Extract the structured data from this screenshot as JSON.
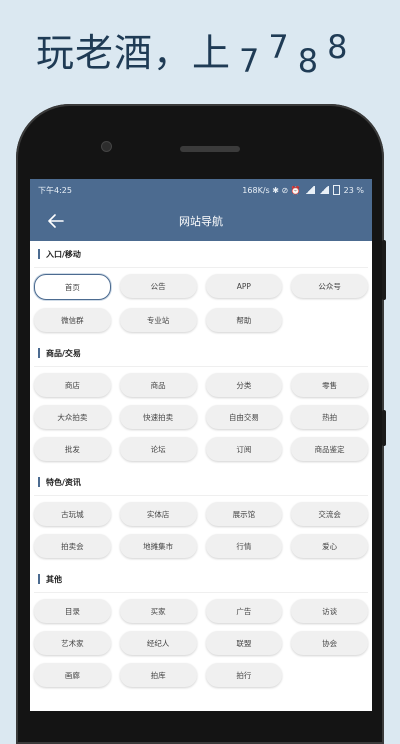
{
  "slogan": {
    "text": "玩老酒，上",
    "d1": "7",
    "d2": "7",
    "d3": "8",
    "d4": "8"
  },
  "status_bar": {
    "time": "下午4:25",
    "right": "168K/s ✱ ⊘ ⏰",
    "battery": "23 %"
  },
  "appbar": {
    "title": "网站导航"
  },
  "accent_color": "#4c6b90",
  "sections": [
    {
      "title": "入口/移动",
      "items": [
        "首页",
        "公告",
        "APP",
        "公众号",
        "微信群",
        "专业站",
        "帮助"
      ]
    },
    {
      "title": "商品/交易",
      "items": [
        "商店",
        "商品",
        "分类",
        "零售",
        "大众拍卖",
        "快速拍卖",
        "自由交易",
        "热拍",
        "批发",
        "论坛",
        "订阅",
        "商品鉴定"
      ]
    },
    {
      "title": "特色/资讯",
      "items": [
        "古玩城",
        "实体店",
        "展示馆",
        "交流会",
        "拍卖会",
        "地摊集市",
        "行情",
        "爱心"
      ]
    },
    {
      "title": "其他",
      "items": [
        "目录",
        "买家",
        "广告",
        "访谈",
        "艺术家",
        "经纪人",
        "联盟",
        "协会",
        "画廊",
        "拍库",
        "拍行"
      ]
    }
  ]
}
